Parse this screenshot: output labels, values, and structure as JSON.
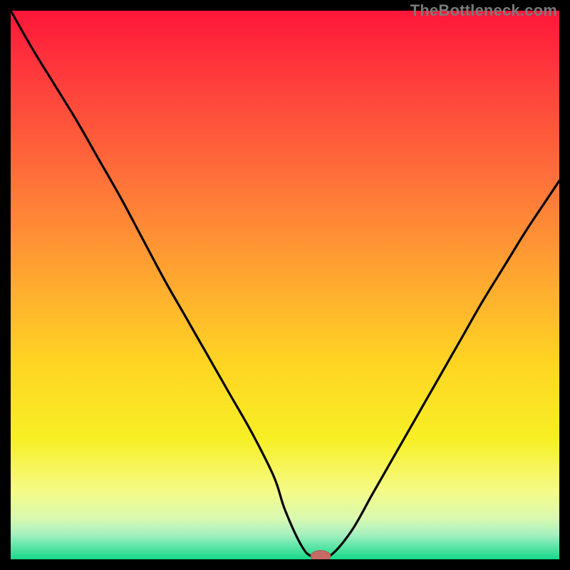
{
  "watermark": "TheBottleneck.com",
  "colors": {
    "gradient_stops": [
      {
        "offset": 0.0,
        "color": "#ff163a"
      },
      {
        "offset": 0.12,
        "color": "#ff3b3c"
      },
      {
        "offset": 0.3,
        "color": "#ff6f3a"
      },
      {
        "offset": 0.48,
        "color": "#ffa531"
      },
      {
        "offset": 0.64,
        "color": "#ffd423"
      },
      {
        "offset": 0.78,
        "color": "#f7ef24"
      },
      {
        "offset": 0.875,
        "color": "#f5fa86"
      },
      {
        "offset": 0.925,
        "color": "#d9f9b0"
      },
      {
        "offset": 0.955,
        "color": "#a6f0c0"
      },
      {
        "offset": 0.975,
        "color": "#62e6a9"
      },
      {
        "offset": 1.0,
        "color": "#16da8a"
      }
    ],
    "curve": "#000000",
    "marker_fill": "#c66a63",
    "marker_stroke": "#b25852"
  },
  "chart_data": {
    "type": "line",
    "title": "",
    "xlabel": "",
    "ylabel": "",
    "xlim": [
      0,
      100
    ],
    "ylim": [
      0,
      100
    ],
    "grid": false,
    "legend": false,
    "series": [
      {
        "name": "bottleneck-curve",
        "x": [
          0,
          4,
          8,
          12,
          16,
          20,
          24,
          28,
          32,
          36,
          40,
          44,
          48,
          50,
          53,
          55,
          58,
          62,
          66,
          70,
          74,
          78,
          82,
          86,
          90,
          94,
          98,
          100
        ],
        "y": [
          100,
          93,
          86.5,
          80,
          73,
          66,
          58.5,
          51,
          44,
          37,
          30,
          23,
          15,
          9,
          2.5,
          0.5,
          0.5,
          5,
          12,
          19,
          26,
          33,
          40,
          47,
          53.5,
          60,
          66,
          69
        ]
      }
    ],
    "marker": {
      "x": 56.5,
      "y": 0.6,
      "rx": 1.8,
      "ry": 1.0
    }
  }
}
